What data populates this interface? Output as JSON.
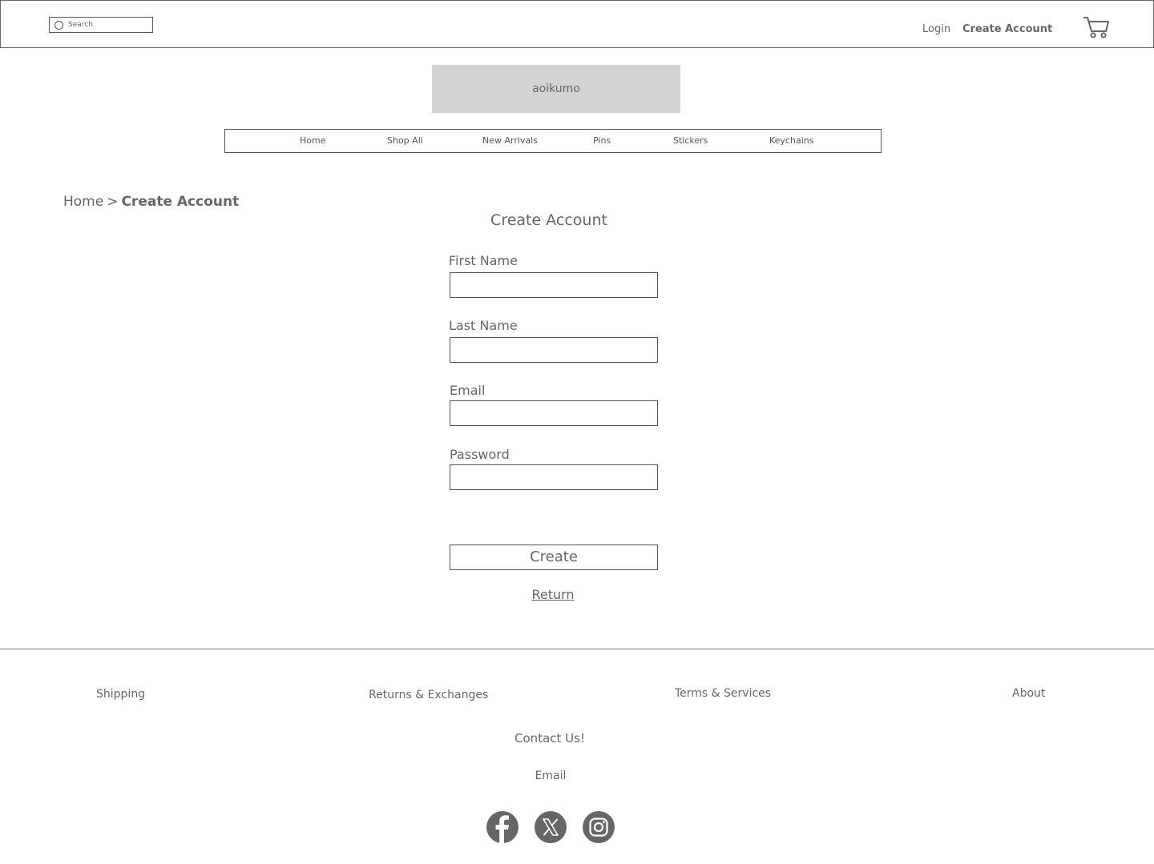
{
  "header": {
    "search_placeholder": "Search",
    "login_label": "Login",
    "create_account_label": "Create Account",
    "icons": {
      "search": "search-icon",
      "cart": "cart-icon"
    }
  },
  "brand": {
    "logo_text": "aoikumo"
  },
  "nav": {
    "items": [
      {
        "label": "Home"
      },
      {
        "label": "Shop All"
      },
      {
        "label": "New Arrivals"
      },
      {
        "label": "Pins"
      },
      {
        "label": "Stickers"
      },
      {
        "label": "Keychains"
      }
    ]
  },
  "breadcrumb": {
    "home": "Home",
    "separator": ">",
    "current": "Create Account"
  },
  "form": {
    "title": "Create Account",
    "fields": [
      {
        "label": "First Name",
        "value": ""
      },
      {
        "label": "Last Name",
        "value": ""
      },
      {
        "label": "Email",
        "value": ""
      },
      {
        "label": "Password",
        "value": ""
      }
    ],
    "submit_label": "Create",
    "return_label": "Return"
  },
  "footer": {
    "links": [
      {
        "label": "Shipping"
      },
      {
        "label": "Returns & Exchanges"
      },
      {
        "label": "Terms & Services"
      },
      {
        "label": "About"
      }
    ],
    "contact_heading": "Contact Us!",
    "contact_email": "Email",
    "social": [
      "facebook-icon",
      "x-icon",
      "instagram-icon"
    ]
  },
  "colors": {
    "text": "#666666",
    "border": "#555555",
    "logo_bg": "#d3d3d3",
    "social_bg": "#666666"
  }
}
